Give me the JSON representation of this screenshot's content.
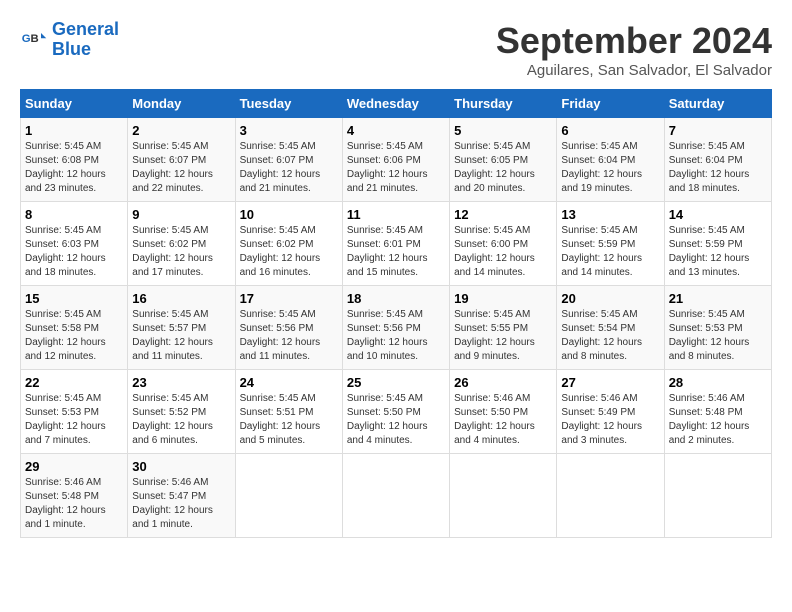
{
  "logo": {
    "line1": "General",
    "line2": "Blue"
  },
  "title": "September 2024",
  "subtitle": "Aguilares, San Salvador, El Salvador",
  "days_of_week": [
    "Sunday",
    "Monday",
    "Tuesday",
    "Wednesday",
    "Thursday",
    "Friday",
    "Saturday"
  ],
  "weeks": [
    [
      {
        "day": "1",
        "sunrise": "5:45 AM",
        "sunset": "6:08 PM",
        "daylight": "12 hours and 23 minutes."
      },
      {
        "day": "2",
        "sunrise": "5:45 AM",
        "sunset": "6:07 PM",
        "daylight": "12 hours and 22 minutes."
      },
      {
        "day": "3",
        "sunrise": "5:45 AM",
        "sunset": "6:07 PM",
        "daylight": "12 hours and 21 minutes."
      },
      {
        "day": "4",
        "sunrise": "5:45 AM",
        "sunset": "6:06 PM",
        "daylight": "12 hours and 21 minutes."
      },
      {
        "day": "5",
        "sunrise": "5:45 AM",
        "sunset": "6:05 PM",
        "daylight": "12 hours and 20 minutes."
      },
      {
        "day": "6",
        "sunrise": "5:45 AM",
        "sunset": "6:04 PM",
        "daylight": "12 hours and 19 minutes."
      },
      {
        "day": "7",
        "sunrise": "5:45 AM",
        "sunset": "6:04 PM",
        "daylight": "12 hours and 18 minutes."
      }
    ],
    [
      {
        "day": "8",
        "sunrise": "5:45 AM",
        "sunset": "6:03 PM",
        "daylight": "12 hours and 18 minutes."
      },
      {
        "day": "9",
        "sunrise": "5:45 AM",
        "sunset": "6:02 PM",
        "daylight": "12 hours and 17 minutes."
      },
      {
        "day": "10",
        "sunrise": "5:45 AM",
        "sunset": "6:02 PM",
        "daylight": "12 hours and 16 minutes."
      },
      {
        "day": "11",
        "sunrise": "5:45 AM",
        "sunset": "6:01 PM",
        "daylight": "12 hours and 15 minutes."
      },
      {
        "day": "12",
        "sunrise": "5:45 AM",
        "sunset": "6:00 PM",
        "daylight": "12 hours and 14 minutes."
      },
      {
        "day": "13",
        "sunrise": "5:45 AM",
        "sunset": "5:59 PM",
        "daylight": "12 hours and 14 minutes."
      },
      {
        "day": "14",
        "sunrise": "5:45 AM",
        "sunset": "5:59 PM",
        "daylight": "12 hours and 13 minutes."
      }
    ],
    [
      {
        "day": "15",
        "sunrise": "5:45 AM",
        "sunset": "5:58 PM",
        "daylight": "12 hours and 12 minutes."
      },
      {
        "day": "16",
        "sunrise": "5:45 AM",
        "sunset": "5:57 PM",
        "daylight": "12 hours and 11 minutes."
      },
      {
        "day": "17",
        "sunrise": "5:45 AM",
        "sunset": "5:56 PM",
        "daylight": "12 hours and 11 minutes."
      },
      {
        "day": "18",
        "sunrise": "5:45 AM",
        "sunset": "5:56 PM",
        "daylight": "12 hours and 10 minutes."
      },
      {
        "day": "19",
        "sunrise": "5:45 AM",
        "sunset": "5:55 PM",
        "daylight": "12 hours and 9 minutes."
      },
      {
        "day": "20",
        "sunrise": "5:45 AM",
        "sunset": "5:54 PM",
        "daylight": "12 hours and 8 minutes."
      },
      {
        "day": "21",
        "sunrise": "5:45 AM",
        "sunset": "5:53 PM",
        "daylight": "12 hours and 8 minutes."
      }
    ],
    [
      {
        "day": "22",
        "sunrise": "5:45 AM",
        "sunset": "5:53 PM",
        "daylight": "12 hours and 7 minutes."
      },
      {
        "day": "23",
        "sunrise": "5:45 AM",
        "sunset": "5:52 PM",
        "daylight": "12 hours and 6 minutes."
      },
      {
        "day": "24",
        "sunrise": "5:45 AM",
        "sunset": "5:51 PM",
        "daylight": "12 hours and 5 minutes."
      },
      {
        "day": "25",
        "sunrise": "5:45 AM",
        "sunset": "5:50 PM",
        "daylight": "12 hours and 4 minutes."
      },
      {
        "day": "26",
        "sunrise": "5:46 AM",
        "sunset": "5:50 PM",
        "daylight": "12 hours and 4 minutes."
      },
      {
        "day": "27",
        "sunrise": "5:46 AM",
        "sunset": "5:49 PM",
        "daylight": "12 hours and 3 minutes."
      },
      {
        "day": "28",
        "sunrise": "5:46 AM",
        "sunset": "5:48 PM",
        "daylight": "12 hours and 2 minutes."
      }
    ],
    [
      {
        "day": "29",
        "sunrise": "5:46 AM",
        "sunset": "5:48 PM",
        "daylight": "12 hours and 1 minute."
      },
      {
        "day": "30",
        "sunrise": "5:46 AM",
        "sunset": "5:47 PM",
        "daylight": "12 hours and 1 minute."
      },
      null,
      null,
      null,
      null,
      null
    ]
  ],
  "labels": {
    "sunrise": "Sunrise:",
    "sunset": "Sunset:",
    "daylight": "Daylight:"
  }
}
